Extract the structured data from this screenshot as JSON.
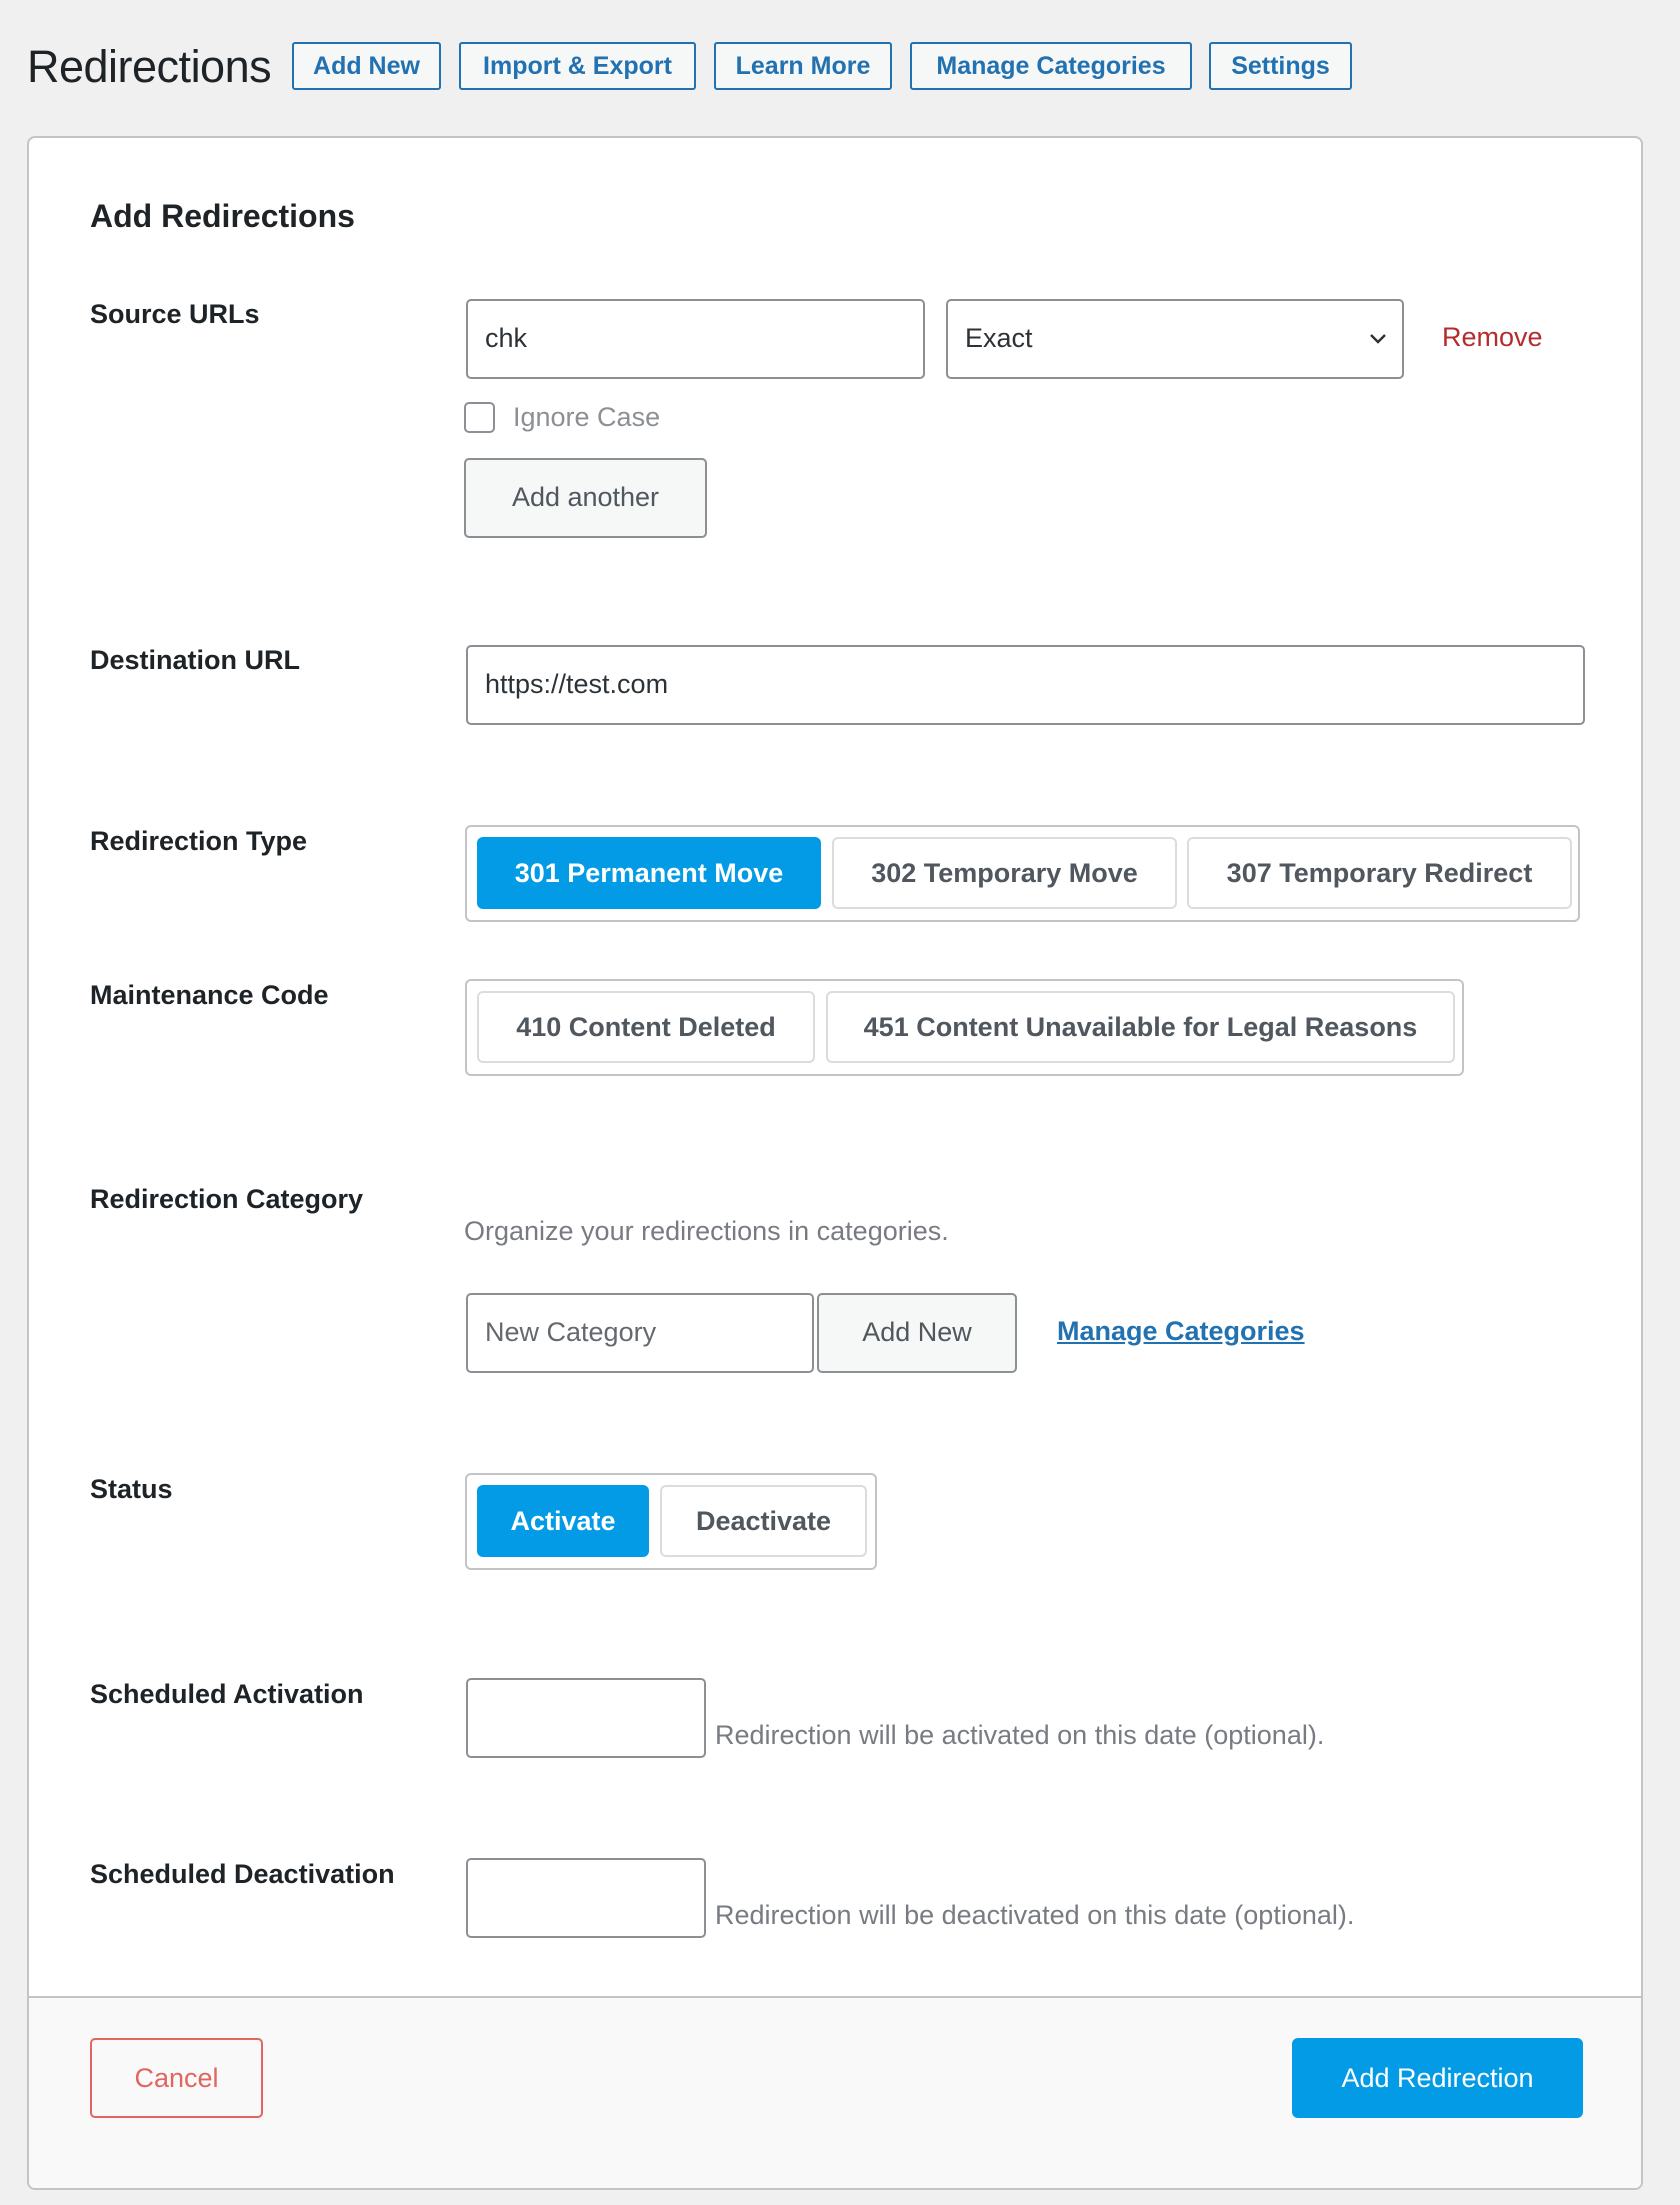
{
  "header": {
    "title": "Redirections",
    "buttons": [
      {
        "label": "Add New"
      },
      {
        "label": "Import & Export"
      },
      {
        "label": "Learn More"
      },
      {
        "label": "Manage Categories"
      },
      {
        "label": "Settings"
      }
    ]
  },
  "form": {
    "title": "Add Redirections",
    "source_urls": {
      "label": "Source URLs",
      "value": "chk",
      "match_type": "Exact",
      "remove_label": "Remove",
      "ignore_case_label": "Ignore Case",
      "ignore_case_checked": false,
      "add_another_label": "Add another"
    },
    "destination": {
      "label": "Destination URL",
      "value": "https://test.com"
    },
    "redirection_type": {
      "label": "Redirection Type",
      "options": [
        {
          "label": "301 Permanent Move",
          "selected": true
        },
        {
          "label": "302 Temporary Move",
          "selected": false
        },
        {
          "label": "307 Temporary Redirect",
          "selected": false
        }
      ]
    },
    "maintenance_code": {
      "label": "Maintenance Code",
      "options": [
        {
          "label": "410 Content Deleted",
          "selected": false
        },
        {
          "label": "451 Content Unavailable for Legal Reasons",
          "selected": false
        }
      ]
    },
    "category": {
      "label": "Redirection Category",
      "help": "Organize your redirections in categories.",
      "new_category_placeholder": "New Category",
      "add_new_label": "Add New",
      "manage_link": "Manage Categories"
    },
    "status": {
      "label": "Status",
      "options": [
        {
          "label": "Activate",
          "selected": true
        },
        {
          "label": "Deactivate",
          "selected": false
        }
      ]
    },
    "scheduled_activation": {
      "label": "Scheduled Activation",
      "value": "",
      "help": "Redirection will be activated on this date (optional)."
    },
    "scheduled_deactivation": {
      "label": "Scheduled Deactivation",
      "value": "",
      "help": "Redirection will be deactivated on this date (optional)."
    }
  },
  "footer": {
    "cancel_label": "Cancel",
    "submit_label": "Add Redirection"
  },
  "colors": {
    "accent": "#039be5",
    "link": "#2271b1",
    "danger": "#b32d2e",
    "cancel": "#e0675f"
  }
}
